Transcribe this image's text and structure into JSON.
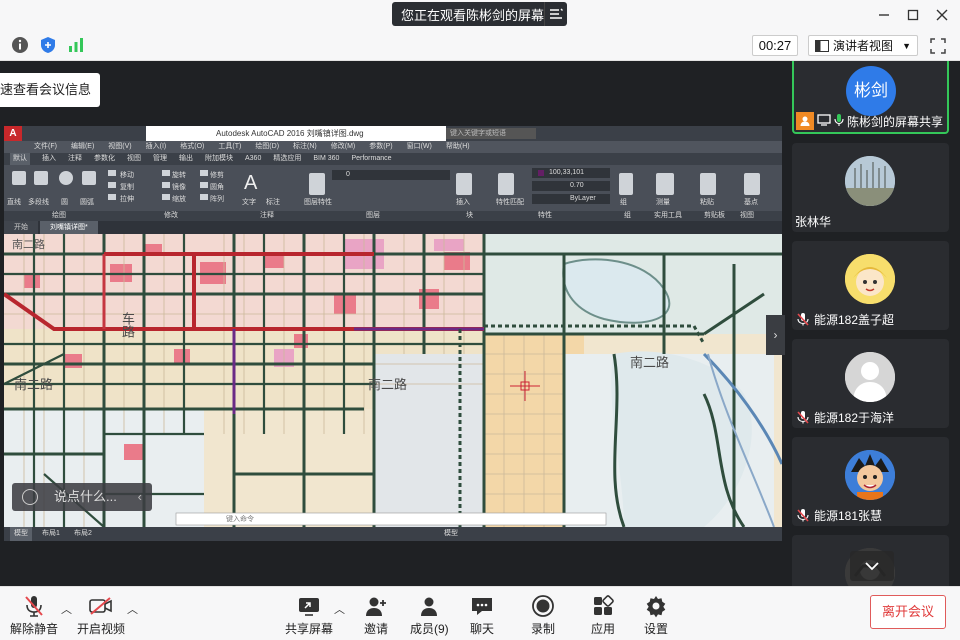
{
  "titlebar": {
    "share_banner": "您正在观看陈彬剑的屏幕",
    "icons": [
      "list-menu-icon",
      "minimize-icon",
      "maximize-icon",
      "close-icon"
    ]
  },
  "infobar": {
    "timer": "00:27",
    "view_mode": "演讲者视图",
    "icons": [
      "info-icon",
      "shield-icon",
      "signal-icon",
      "fullscreen-icon"
    ]
  },
  "tip": {
    "text": "速查看会议信息"
  },
  "shared_screen": {
    "app_title": "Autodesk AutoCAD 2016   刘嘴镇详图.dwg",
    "search_placeholder": "键入关键字或短语",
    "menus": [
      "文件(F)",
      "编辑(E)",
      "视图(V)",
      "插入(I)",
      "格式(O)",
      "工具(T)",
      "绘图(D)",
      "标注(N)",
      "修改(M)",
      "参数(P)",
      "窗口(W)",
      "帮助(H)"
    ],
    "ribbon_tabs": [
      "默认",
      "插入",
      "注释",
      "参数化",
      "视图",
      "管理",
      "输出",
      "附加模块",
      "A360",
      "精选应用",
      "BIM 360",
      "Performance"
    ],
    "ribbon_labels": [
      "直线",
      "多段线",
      "圆",
      "圆弧",
      "移动",
      "旋转",
      "修剪",
      "复制",
      "镜像",
      "圆角",
      "拉伸",
      "缩放",
      "阵列",
      "文字",
      "标注",
      "图层特性",
      "插入",
      "特性匹配",
      "组",
      "测量",
      "粘贴",
      "基点"
    ],
    "layer_value": "0",
    "color_value": "100,33,101",
    "lineweight_value": "0.70",
    "linetype_value": "ByLayer",
    "ribbon_groups": [
      "绘图",
      "修改",
      "注释",
      "图层",
      "块",
      "特性",
      "组",
      "实用工具",
      "剪贴板",
      "视图"
    ],
    "doc_tabs": [
      "开始",
      "刘嘴镇详图*"
    ],
    "map_labels": [
      "南二路",
      "车路",
      "南二路",
      "南二路",
      "南二路"
    ],
    "command_placeholder": "键入命令",
    "layout_tabs": [
      "模型",
      "布局1",
      "布局2"
    ],
    "status_model": "模型"
  },
  "chat_input": {
    "placeholder": "说点什么..."
  },
  "participants": [
    {
      "name": "陈彬剑的屏幕共享",
      "avatar_text": "彬剑",
      "avatar_color": "#2f7be8",
      "muted": false,
      "active": true
    },
    {
      "name": "张林华",
      "muted": false
    },
    {
      "name": "能源182盖子超",
      "muted": true
    },
    {
      "name": "能源182于海洋",
      "muted": true
    },
    {
      "name": "能源181张慧",
      "muted": true
    },
    {
      "name": "",
      "muted": false
    }
  ],
  "toolbar": {
    "unmute": "解除静音",
    "start_video": "开启视频",
    "share_screen": "共享屏幕",
    "invite": "邀请",
    "members": "成员(9)",
    "chat": "聊天",
    "record": "录制",
    "apps": "应用",
    "settings": "设置",
    "leave": "离开会议"
  },
  "colors": {
    "active_border": "#34c759",
    "leave_red": "#e03a3a",
    "mic_red": "#e5484d",
    "brand_blue": "#2f7be8"
  }
}
